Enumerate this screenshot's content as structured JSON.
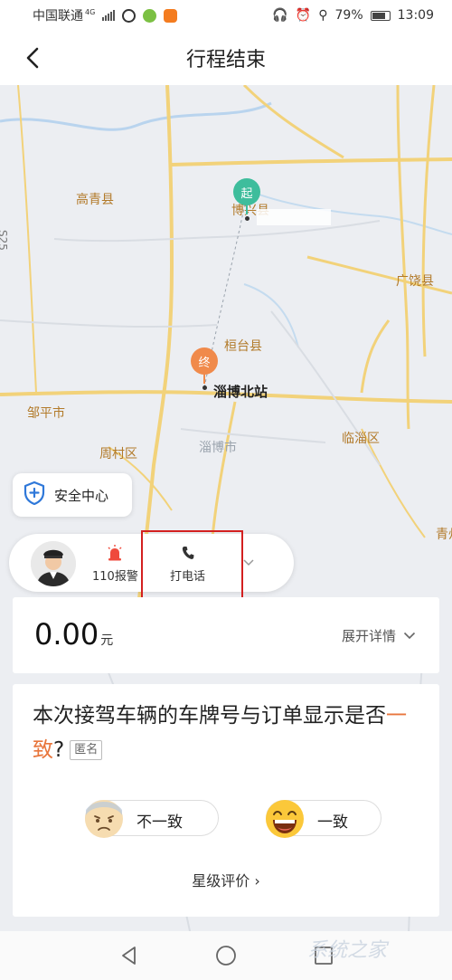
{
  "status_bar": {
    "carrier": "中国联通",
    "network": "4G",
    "battery": "79%",
    "time": "13:09"
  },
  "header": {
    "title": "行程结束"
  },
  "map": {
    "labels": {
      "gaoqing": "高青县",
      "boxing": "博兴县",
      "s25": "S25",
      "guangrao": "广饶县",
      "huantai": "桓台县",
      "zibo_north": "淄博北站",
      "zouping": "邹平市",
      "zhoucun": "周村区",
      "zibo": "淄博市",
      "linzi": "临淄区",
      "qing": "青州"
    },
    "start_marker": "起",
    "end_marker": "终"
  },
  "safety": {
    "label": "安全中心"
  },
  "driver_bar": {
    "police_label": "110报警",
    "call_label": "打电话"
  },
  "fare": {
    "amount": "0.00",
    "unit": "元",
    "detail_label": "展开详情"
  },
  "survey": {
    "question_prefix": "本次接驾车辆的车牌号与订单显示是否",
    "question_accent": "一致",
    "question_suffix": "?",
    "anonymous_tag": "匿名",
    "option_no": "不一致",
    "option_yes": "一致",
    "rating_link": "星级评价 ›"
  },
  "watermark": "系统之家"
}
